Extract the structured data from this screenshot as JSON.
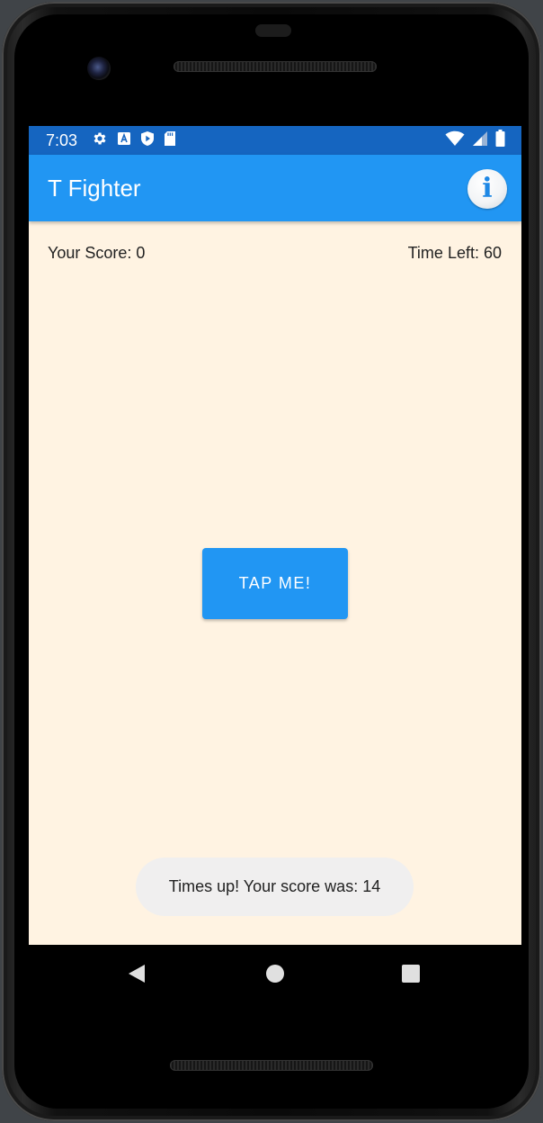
{
  "status_bar": {
    "time": "7:03",
    "left_icons": [
      "gear-icon",
      "a-notification-icon",
      "shield-play-icon",
      "sd-card-icon"
    ],
    "right_icons": [
      "wifi-icon",
      "cell-signal-icon",
      "battery-icon"
    ]
  },
  "app_bar": {
    "title": "T Fighter",
    "info_icon": "info-icon"
  },
  "game": {
    "score_label": "Your Score: 0",
    "time_label": "Time Left: 60",
    "tap_button_label": "TAP ME!"
  },
  "toast": {
    "message": "Times up! Your score was: 14"
  },
  "nav_bar": {
    "icons": [
      "back-icon",
      "home-icon",
      "recents-icon"
    ]
  },
  "colors": {
    "status_bar": "#1565c0",
    "app_bar": "#2196f3",
    "background": "#fff3e2",
    "button": "#2196f3",
    "toast": "#f0efef"
  }
}
